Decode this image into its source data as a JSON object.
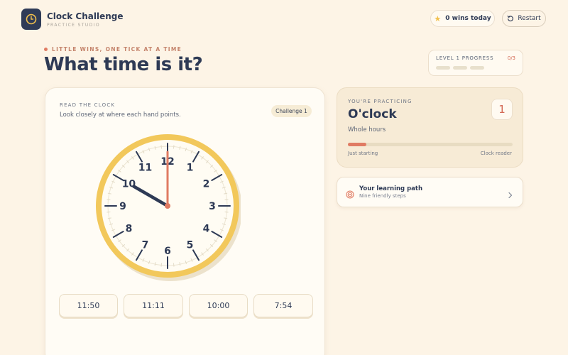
{
  "app": {
    "title": "Clock Challenge",
    "subtitle": "PRACTICE STUDIO"
  },
  "header": {
    "wins_label": "0 wins today",
    "restart_label": "Restart"
  },
  "hero": {
    "tagline": "LITTLE WINS, ONE TICK AT A TIME",
    "title": "What time is it?"
  },
  "progress": {
    "label": "LEVEL 1 PROGRESS",
    "count": "0/3",
    "completed": 0,
    "total": 3
  },
  "clock_card": {
    "eyebrow": "READ THE CLOCK",
    "hint": "Look closely at where each hand points.",
    "challenge": "Challenge 1",
    "numbers": [
      "12",
      "1",
      "2",
      "3",
      "4",
      "5",
      "6",
      "7",
      "8",
      "9",
      "10",
      "11"
    ],
    "displayed_time": {
      "hour": 10,
      "minute": 0
    }
  },
  "options": [
    "11:50",
    "11:11",
    "10:00",
    "7:54"
  ],
  "practice": {
    "eyebrow": "YOU'RE PRACTICING",
    "title": "O'clock",
    "subtitle": "Whole hours",
    "level": "1",
    "progress_fraction": 0.11,
    "start_label": "Just starting",
    "end_label": "Clock reader"
  },
  "learning_path": {
    "title": "Your learning path",
    "subtitle": "Nine friendly steps"
  },
  "icons": {
    "logo": "clock-icon",
    "wins": "star-icon",
    "restart": "restart-icon",
    "path": "target-icon",
    "chevron": "chevron-right-icon"
  },
  "colors": {
    "background": "#fdf4e6",
    "navy": "#2e3a55",
    "accent": "#e07b63",
    "clock_rim": "#f2c85b",
    "star": "#f2c14e"
  }
}
